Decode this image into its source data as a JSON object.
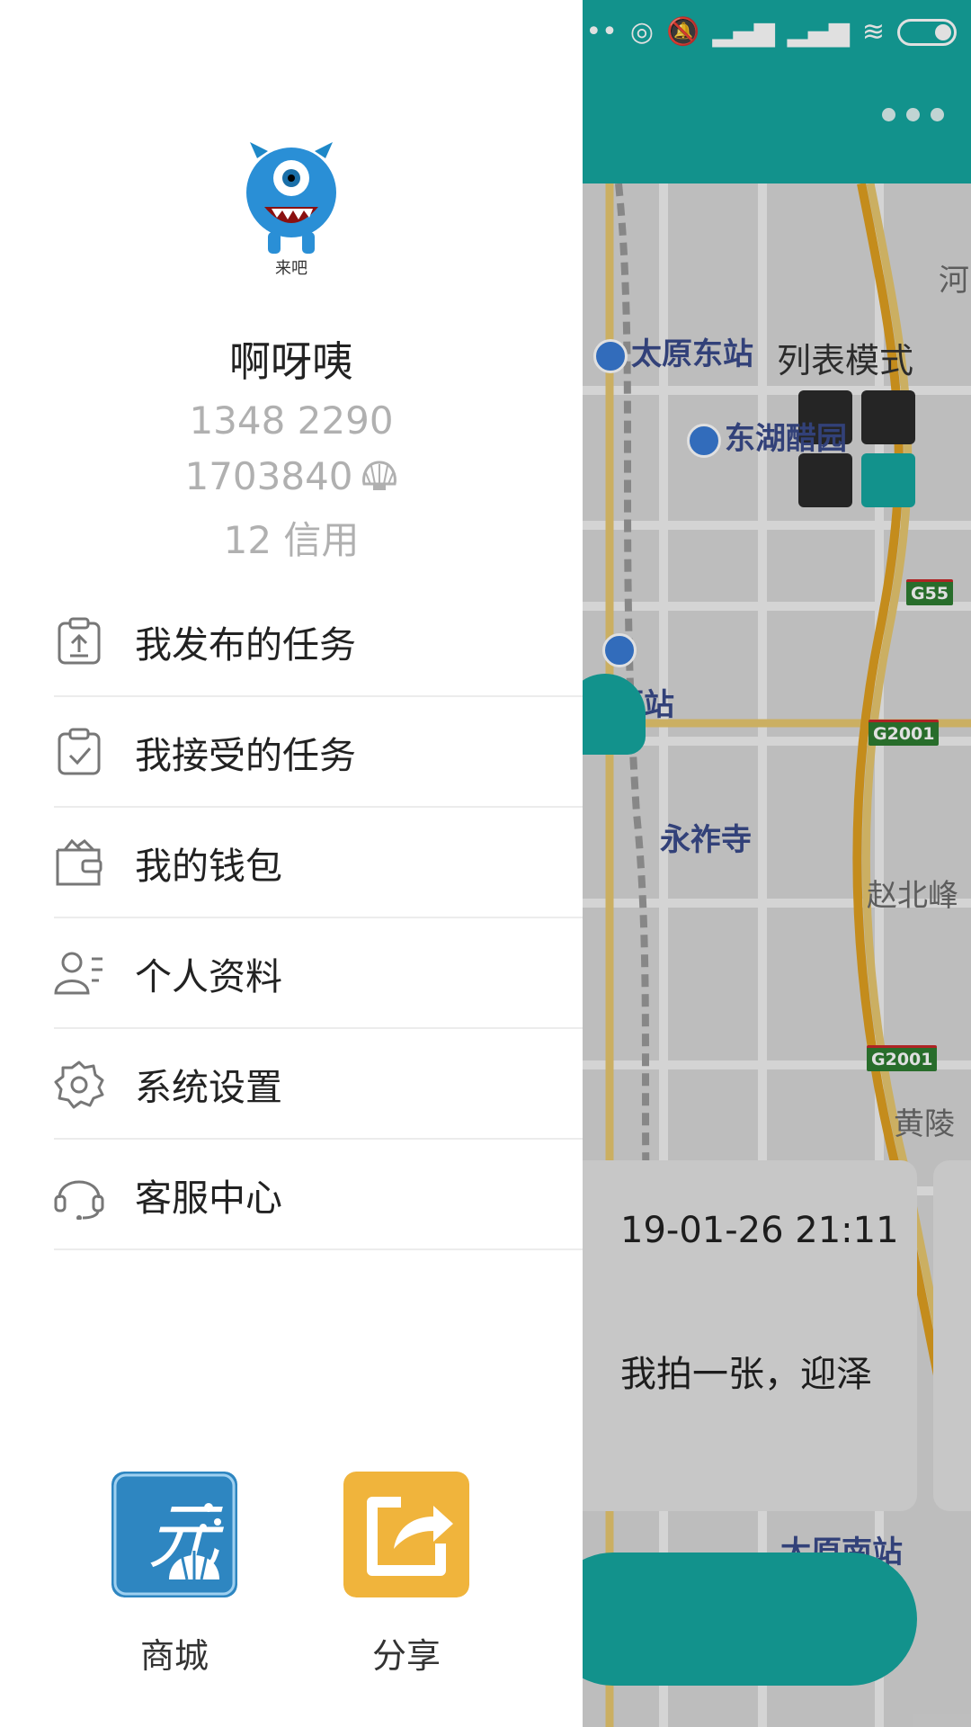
{
  "status_bar": {
    "icons": [
      "signal-dots-icon",
      "hotspot-icon",
      "mute-icon",
      "signal-1-icon",
      "signal-2-icon",
      "wifi-icon",
      "battery-icon"
    ]
  },
  "map": {
    "mode_toggle": "列表模式",
    "places": {
      "taiyuan_east": "太原东站",
      "donghu": "东湖醋园",
      "taiyuan": "太原站",
      "yongzuo": "永祚寺",
      "zhaobei": "赵北峰",
      "huangling": "黄陵",
      "he": "河",
      "taiyuan_south": "太原南站"
    },
    "roads": {
      "g55": "G55",
      "g2001_a": "G2001",
      "g2001_b": "G2001"
    },
    "task_card": {
      "time": "19-01-26 21:11",
      "text": "我拍一张，迎泽"
    }
  },
  "drawer": {
    "avatar_text": "来吧",
    "username": "啊呀咦",
    "phone": "1348 2290",
    "shells": "1703840",
    "credit": "12 信用",
    "menu": [
      {
        "label": "我发布的任务",
        "icon": "upload-clipboard-icon"
      },
      {
        "label": "我接受的任务",
        "icon": "check-clipboard-icon"
      },
      {
        "label": "我的钱包",
        "icon": "wallet-icon"
      },
      {
        "label": "个人资料",
        "icon": "profile-icon"
      },
      {
        "label": "系统设置",
        "icon": "gear-icon"
      },
      {
        "label": "客服中心",
        "icon": "headset-icon"
      }
    ],
    "bottom": {
      "mall": "商城",
      "share": "分享"
    }
  },
  "colors": {
    "brand": "#15a7a0",
    "share": "#f0b43c",
    "mall": "#2e86c1"
  }
}
